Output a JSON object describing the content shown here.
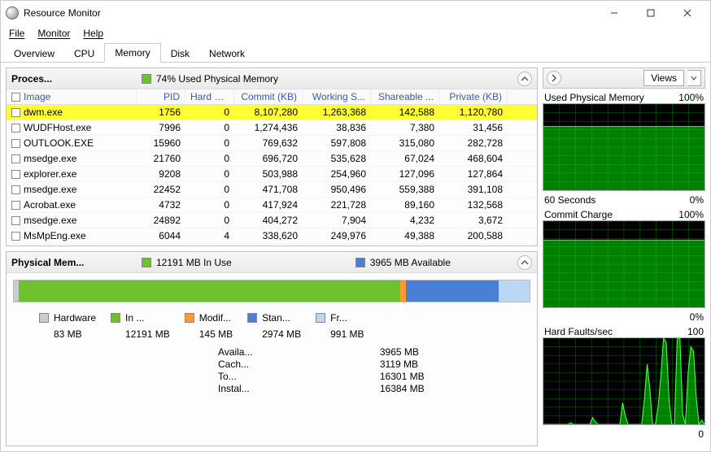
{
  "window": {
    "title": "Resource Monitor"
  },
  "menu": {
    "file": "File",
    "monitor": "Monitor",
    "help": "Help"
  },
  "tabs": {
    "overview": "Overview",
    "cpu": "CPU",
    "memory": "Memory",
    "disk": "Disk",
    "network": "Network"
  },
  "processes": {
    "title": "Proces...",
    "usage_label": "74% Used Physical Memory",
    "bar_color": "#6fc22e",
    "columns": {
      "image": "Image",
      "pid": "PID",
      "hf": "Hard Faults...",
      "commit": "Commit (KB)",
      "ws": "Working S...",
      "share": "Shareable ...",
      "priv": "Private (KB)"
    },
    "rows": [
      {
        "image": "dwm.exe",
        "pid": "1756",
        "hf": "0",
        "commit": "8,107,280",
        "ws": "1,263,368",
        "share": "142,588",
        "priv": "1,120,780",
        "highlight": true
      },
      {
        "image": "WUDFHost.exe",
        "pid": "7996",
        "hf": "0",
        "commit": "1,274,436",
        "ws": "38,836",
        "share": "7,380",
        "priv": "31,456"
      },
      {
        "image": "OUTLOOK.EXE",
        "pid": "15960",
        "hf": "0",
        "commit": "769,632",
        "ws": "597,808",
        "share": "315,080",
        "priv": "282,728"
      },
      {
        "image": "msedge.exe",
        "pid": "21760",
        "hf": "0",
        "commit": "696,720",
        "ws": "535,628",
        "share": "67,024",
        "priv": "468,604"
      },
      {
        "image": "explorer.exe",
        "pid": "9208",
        "hf": "0",
        "commit": "503,988",
        "ws": "254,960",
        "share": "127,096",
        "priv": "127,864"
      },
      {
        "image": "msedge.exe",
        "pid": "22452",
        "hf": "0",
        "commit": "471,708",
        "ws": "950,496",
        "share": "559,388",
        "priv": "391,108"
      },
      {
        "image": "Acrobat.exe",
        "pid": "4732",
        "hf": "0",
        "commit": "417,924",
        "ws": "221,728",
        "share": "89,160",
        "priv": "132,568"
      },
      {
        "image": "msedge.exe",
        "pid": "24892",
        "hf": "0",
        "commit": "404,272",
        "ws": "7,904",
        "share": "4,232",
        "priv": "3,672"
      },
      {
        "image": "MsMpEng.exe",
        "pid": "6044",
        "hf": "4",
        "commit": "338,620",
        "ws": "249,976",
        "share": "49,388",
        "priv": "200,588"
      }
    ]
  },
  "physical_memory": {
    "title": "Physical Mem...",
    "in_use_label": "12191 MB In Use",
    "available_label": "3965 MB Available",
    "segments": [
      {
        "label": "Hardware",
        "value": "83 MB",
        "color": "#cccccc",
        "width_pct": 1
      },
      {
        "label": "In ...",
        "value": "12191 MB",
        "color": "#6fc22e",
        "width_pct": 74
      },
      {
        "label": "Modif...",
        "value": "145 MB",
        "color": "#ff9a2e",
        "width_pct": 1
      },
      {
        "label": "Stan...",
        "value": "2974 MB",
        "color": "#4a7fd6",
        "width_pct": 18
      },
      {
        "label": "Fr...",
        "value": "991 MB",
        "color": "#bcd7f5",
        "width_pct": 6
      }
    ],
    "stats": {
      "available": {
        "k": "Availa...",
        "v": "3965 MB"
      },
      "cached": {
        "k": "Cach...",
        "v": "3119 MB"
      },
      "total": {
        "k": "To...",
        "v": "16301 MB"
      },
      "installed": {
        "k": "Instal...",
        "v": "16384 MB"
      }
    }
  },
  "graphs": {
    "views_label": "Views",
    "used_phys": {
      "title": "Used Physical Memory",
      "max": "100%",
      "footer_left": "60 Seconds",
      "footer_right": "0%"
    },
    "commit": {
      "title": "Commit Charge",
      "max": "100%",
      "footer_left": "",
      "footer_right": "0%"
    },
    "hard_faults": {
      "title": "Hard Faults/sec",
      "max": "100",
      "footer_left": "",
      "footer_right": "0"
    }
  },
  "chart_data": [
    {
      "type": "area",
      "title": "Used Physical Memory",
      "ylabel": "%",
      "ylim": [
        0,
        100
      ],
      "x_seconds": 60,
      "values": [
        74,
        74,
        74,
        74,
        74,
        74,
        74,
        74,
        74,
        74,
        74,
        74,
        74,
        74,
        74,
        74,
        74,
        74,
        74,
        74,
        74,
        74,
        74,
        74,
        74,
        74,
        74,
        74,
        74,
        74,
        74,
        74,
        74,
        74,
        74,
        74,
        74,
        74,
        74,
        74,
        74,
        74,
        74,
        74,
        74,
        74,
        74,
        74,
        74,
        74,
        74,
        74,
        74,
        74,
        74,
        74,
        74,
        74,
        74,
        74
      ]
    },
    {
      "type": "area",
      "title": "Commit Charge",
      "ylabel": "%",
      "ylim": [
        0,
        100
      ],
      "x_seconds": 60,
      "values": [
        78,
        78,
        78,
        78,
        78,
        78,
        78,
        78,
        78,
        78,
        78,
        78,
        78,
        78,
        78,
        78,
        78,
        78,
        78,
        78,
        78,
        78,
        78,
        78,
        78,
        78,
        78,
        78,
        78,
        78,
        78,
        78,
        78,
        78,
        78,
        78,
        78,
        78,
        78,
        78,
        78,
        78,
        78,
        78,
        78,
        78,
        78,
        78,
        78,
        78,
        78,
        78,
        78,
        78,
        78,
        78,
        78,
        78,
        78,
        78
      ]
    },
    {
      "type": "line",
      "title": "Hard Faults/sec",
      "ylabel": "faults/sec",
      "ylim": [
        0,
        100
      ],
      "x_seconds": 60,
      "values": [
        0,
        0,
        0,
        0,
        0,
        0,
        0,
        0,
        0,
        0,
        2,
        0,
        0,
        0,
        0,
        0,
        0,
        0,
        8,
        3,
        0,
        0,
        0,
        0,
        0,
        0,
        0,
        0,
        0,
        25,
        10,
        0,
        0,
        0,
        0,
        0,
        0,
        30,
        70,
        40,
        0,
        0,
        20,
        55,
        100,
        95,
        30,
        0,
        0,
        100,
        100,
        12,
        0,
        60,
        90,
        85,
        30,
        0,
        5,
        0
      ]
    }
  ]
}
